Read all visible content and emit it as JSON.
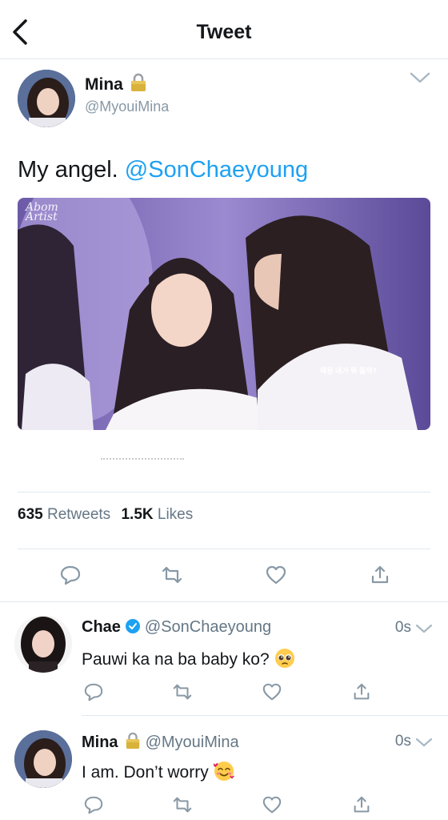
{
  "header": {
    "title": "Tweet"
  },
  "tweet": {
    "author_name": "Mina",
    "author_handle": "@MyouiMina",
    "text": "My angel. ",
    "mention": "@SonChaeyoung",
    "media": {
      "watermark_line1": "Abom",
      "watermark_line2": "Artist",
      "caption": "째용 내가 뭐 줄까?"
    },
    "stats": {
      "retweets": "635",
      "retweets_label": "Retweets",
      "likes": "1.5K",
      "likes_label": "Likes"
    },
    "icons": [
      "chevron-left-icon",
      "lock-icon",
      "chevron-down-icon",
      "reply-icon",
      "retweet-icon",
      "like-icon",
      "share-icon"
    ]
  },
  "replies": [
    {
      "name": "Chae",
      "handle": "@SonChaeyoung",
      "verified": true,
      "time": "0s",
      "text": "Pauwi ka na ba baby ko?",
      "emoji": "pleading-face-emoji"
    },
    {
      "name": "Mina",
      "handle": "@MyouiMina",
      "locked": true,
      "time": "0s",
      "text": "I am. Don’t worry",
      "emoji": "smiling-face-with-hearts-emoji"
    }
  ],
  "colors": {
    "link": "#1da1f2",
    "secondary_text": "#657786",
    "divider": "#e1e8ed",
    "icon": "#8899a6"
  }
}
